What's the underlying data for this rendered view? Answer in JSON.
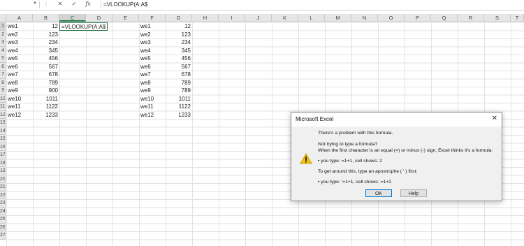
{
  "formula_bar": {
    "name_box": "",
    "cancel_icon": "✕",
    "enter_icon": "✓",
    "fx_label": "fx",
    "formula": "=VLOOKUP(A:A$"
  },
  "columns": [
    "A",
    "B",
    "C",
    "D",
    "E",
    "F",
    "G",
    "H",
    "I",
    "J",
    "K",
    "L",
    "M",
    "N",
    "O",
    "P",
    "Q",
    "R",
    "S",
    "T"
  ],
  "rows": [
    "1",
    "2",
    "3",
    "4",
    "5",
    "6",
    "7",
    "8",
    "9",
    "10",
    "11",
    "12",
    "13",
    "14",
    "15",
    "16",
    "17",
    "18",
    "19",
    "20",
    "21",
    "22",
    "23",
    "24",
    "25",
    "26",
    "27"
  ],
  "table_left": [
    {
      "a": "we1",
      "b": "12"
    },
    {
      "a": "we2",
      "b": "123"
    },
    {
      "a": "we3",
      "b": "234"
    },
    {
      "a": "we4",
      "b": "345"
    },
    {
      "a": "we5",
      "b": "456"
    },
    {
      "a": "we6",
      "b": "567"
    },
    {
      "a": "we7",
      "b": "678"
    },
    {
      "a": "we8",
      "b": "789"
    },
    {
      "a": "we9",
      "b": "900"
    },
    {
      "a": "we10",
      "b": "1011"
    },
    {
      "a": "we11",
      "b": "1122"
    },
    {
      "a": "we12",
      "b": "1233"
    }
  ],
  "active_cell_text": "=VLOOKUP(A:A$",
  "table_right": [
    {
      "f": "we1",
      "g": "12"
    },
    {
      "f": "we2",
      "g": "123"
    },
    {
      "f": "we3",
      "g": "234"
    },
    {
      "f": "we4",
      "g": "345"
    },
    {
      "f": "we5",
      "g": "456"
    },
    {
      "f": "we6",
      "g": "567"
    },
    {
      "f": "we7",
      "g": "678"
    },
    {
      "f": "we8",
      "g": "789"
    },
    {
      "f": "we9",
      "g": "789"
    },
    {
      "f": "we10",
      "g": "1011"
    },
    {
      "f": "we11",
      "g": "1122"
    },
    {
      "f": "we12",
      "g": "1233"
    }
  ],
  "dialog": {
    "title": "Microsoft Excel",
    "close_icon": "✕",
    "lines": [
      "There's a problem with this formula.",
      "Not trying to type a formula?",
      "When the first character is an equal (=) or minus (-) sign, Excel thinks it's a formula:",
      "• you type:   =1+1, cell shows:   2",
      "To get around this, type an apostrophe ( ' ) first:",
      "• you type:   '=1+1, cell shows:   =1+1"
    ],
    "ok_label": "OK",
    "help_label": "Help"
  }
}
